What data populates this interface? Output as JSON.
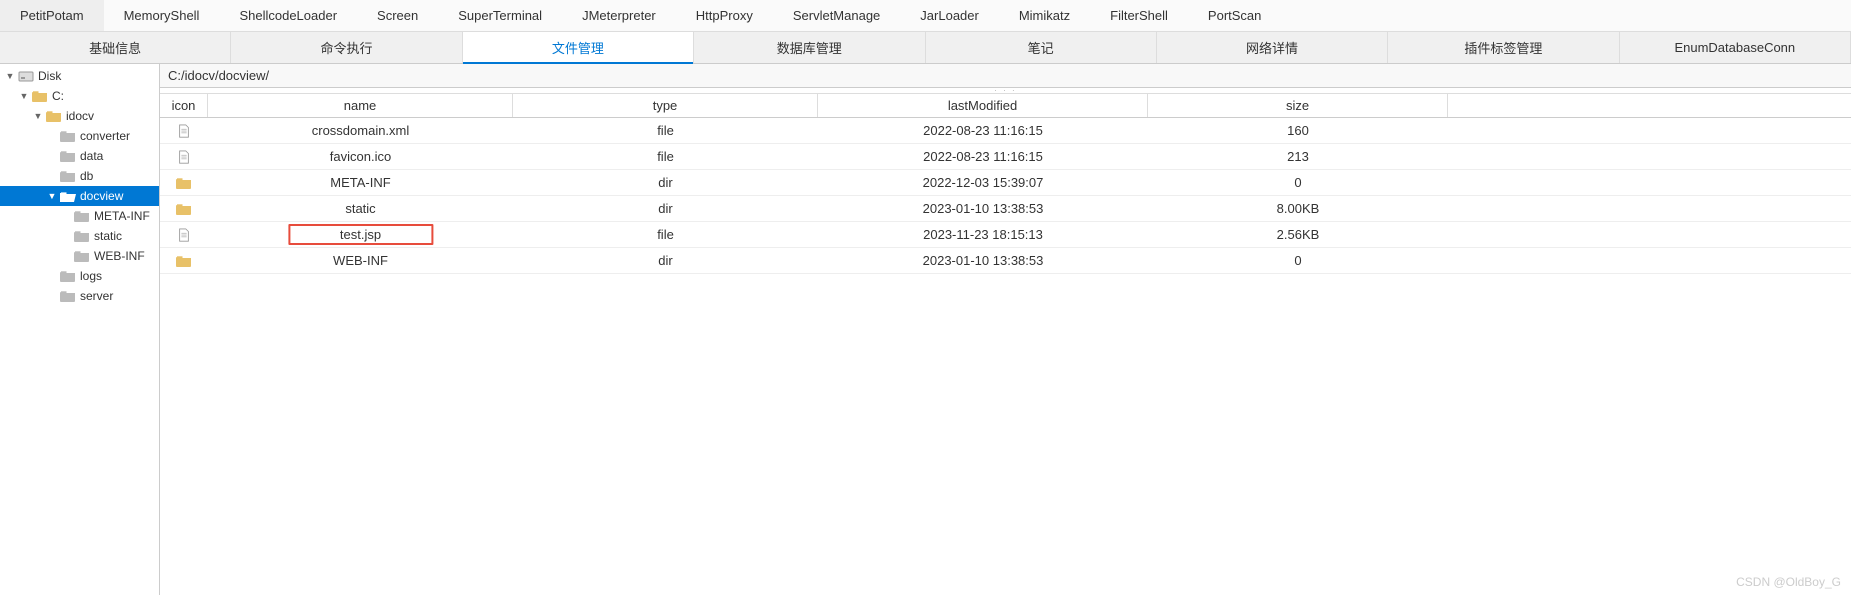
{
  "topTabs": [
    "PetitPotam",
    "MemoryShell",
    "ShellcodeLoader",
    "Screen",
    "SuperTerminal",
    "JMeterpreter",
    "HttpProxy",
    "ServletManage",
    "JarLoader",
    "Mimikatz",
    "FilterShell",
    "PortScan"
  ],
  "subTabs": [
    {
      "label": "基础信息",
      "active": false
    },
    {
      "label": "命令执行",
      "active": false
    },
    {
      "label": "文件管理",
      "active": true
    },
    {
      "label": "数据库管理",
      "active": false
    },
    {
      "label": "笔记",
      "active": false
    },
    {
      "label": "网络详情",
      "active": false
    },
    {
      "label": "插件标签管理",
      "active": false
    },
    {
      "label": "EnumDatabaseConn",
      "active": false
    }
  ],
  "tree": [
    {
      "label": "Disk",
      "indent": 0,
      "toggle": "▼",
      "icon": "disk",
      "selected": false
    },
    {
      "label": "C:",
      "indent": 1,
      "toggle": "▼",
      "icon": "folder",
      "selected": false
    },
    {
      "label": "idocv",
      "indent": 2,
      "toggle": "▼",
      "icon": "folder",
      "selected": false
    },
    {
      "label": "converter",
      "indent": 3,
      "toggle": "",
      "icon": "folder-gray",
      "selected": false
    },
    {
      "label": "data",
      "indent": 3,
      "toggle": "",
      "icon": "folder-gray",
      "selected": false
    },
    {
      "label": "db",
      "indent": 3,
      "toggle": "",
      "icon": "folder-gray",
      "selected": false
    },
    {
      "label": "docview",
      "indent": 3,
      "toggle": "▼",
      "icon": "folder-open",
      "selected": true
    },
    {
      "label": "META-INF",
      "indent": 4,
      "toggle": "",
      "icon": "folder-gray",
      "selected": false
    },
    {
      "label": "static",
      "indent": 4,
      "toggle": "",
      "icon": "folder-gray",
      "selected": false
    },
    {
      "label": "WEB-INF",
      "indent": 4,
      "toggle": "",
      "icon": "folder-gray",
      "selected": false
    },
    {
      "label": "logs",
      "indent": 3,
      "toggle": "",
      "icon": "folder-gray",
      "selected": false
    },
    {
      "label": "server",
      "indent": 3,
      "toggle": "",
      "icon": "folder-gray",
      "selected": false
    }
  ],
  "path": "C:/idocv/docview/",
  "columns": {
    "icon": "icon",
    "name": "name",
    "type": "type",
    "lastModified": "lastModified",
    "size": "size"
  },
  "files": [
    {
      "icon": "file",
      "name": "crossdomain.xml",
      "type": "file",
      "lastModified": "2022-08-23 11:16:15",
      "size": "160",
      "highlight": false
    },
    {
      "icon": "file",
      "name": "favicon.ico",
      "type": "file",
      "lastModified": "2022-08-23 11:16:15",
      "size": "213",
      "highlight": false
    },
    {
      "icon": "folder",
      "name": "META-INF",
      "type": "dir",
      "lastModified": "2022-12-03 15:39:07",
      "size": "0",
      "highlight": false
    },
    {
      "icon": "folder",
      "name": "static",
      "type": "dir",
      "lastModified": "2023-01-10 13:38:53",
      "size": "8.00KB",
      "highlight": false
    },
    {
      "icon": "file",
      "name": "test.jsp",
      "type": "file",
      "lastModified": "2023-11-23 18:15:13",
      "size": "2.56KB",
      "highlight": true
    },
    {
      "icon": "folder",
      "name": "WEB-INF",
      "type": "dir",
      "lastModified": "2023-01-10 13:38:53",
      "size": "0",
      "highlight": false
    }
  ],
  "watermark": "CSDN @OldBoy_G"
}
